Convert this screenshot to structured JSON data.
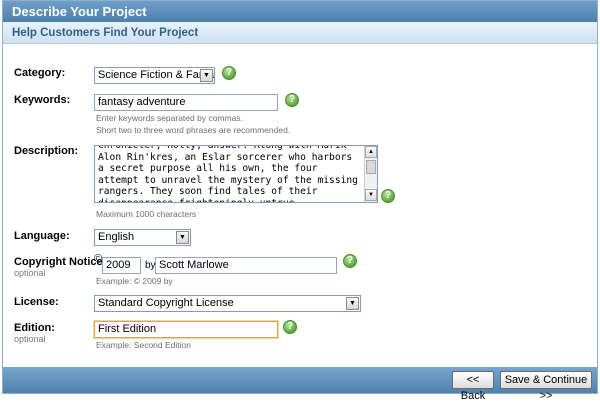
{
  "header": {
    "title": "Describe Your Project",
    "subtitle": "Help Customers Find Your Project"
  },
  "category": {
    "label": "Category:",
    "selected": "Science Fiction & Fantasy"
  },
  "keywords": {
    "label": "Keywords:",
    "value": "fantasy adventure",
    "hint1": "Enter keywords separated by commas.",
    "hint2": "Short two to three word phrases are recommended."
  },
  "description": {
    "label": "Description:",
    "text": "chronicler, Holly, answer. Along with Murik Alon Rin'kres, an Eslar sorcerer who harbors a secret purpose all his own, the four attempt to unravel the mystery of the missing rangers. They soon find tales of their disappearance frighteningly untrue.",
    "hint": "Maximum 1000 characters"
  },
  "language": {
    "label": "Language:",
    "selected": "English"
  },
  "copyright": {
    "label": "Copyright Notice:",
    "optional": "optional",
    "symbol": "©",
    "year": "2009",
    "by": "by",
    "name": "Scott Marlowe",
    "hint": "Example: © 2009 by"
  },
  "license": {
    "label": "License:",
    "selected": "Standard Copyright License"
  },
  "edition": {
    "label": "Edition:",
    "optional": "optional",
    "value": "First Edition",
    "hint": "Example: Second Edition"
  },
  "help_glyph": "?",
  "footer": {
    "back_label": "<< Back",
    "continue_label": "Save & Continue >>"
  },
  "icons": [
    "help-icon",
    "dropdown-arrow-icon",
    "scroll-up-icon",
    "scroll-down-icon"
  ],
  "colors": {
    "title_bar": "#5a8bb8",
    "subtitle_text": "#2f5f8f",
    "help_icon": "#5aa63b",
    "focus_border": "#e0a33a"
  }
}
